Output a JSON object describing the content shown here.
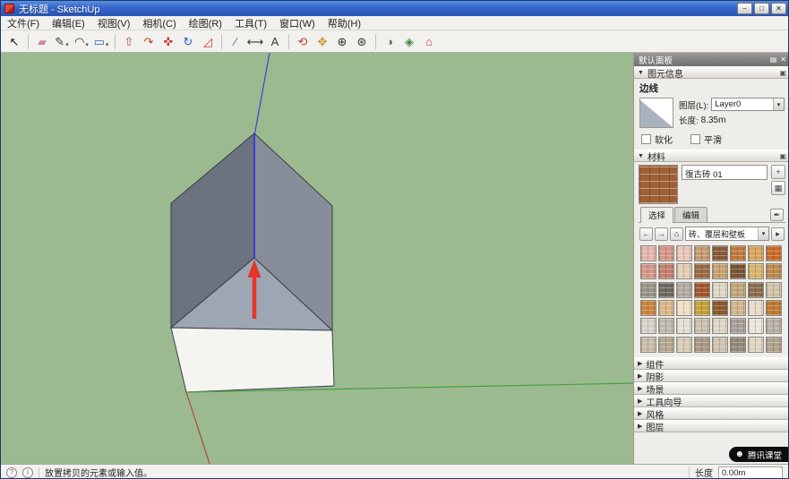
{
  "window": {
    "title": "无标题 - SketchUp",
    "controls": {
      "minimize": "–",
      "maximize": "□",
      "close": "✕"
    }
  },
  "menu": {
    "items": [
      "文件(F)",
      "编辑(E)",
      "视图(V)",
      "相机(C)",
      "绘图(R)",
      "工具(T)",
      "窗口(W)",
      "帮助(H)"
    ]
  },
  "icons": {
    "collapse": "▼",
    "expand": "▶",
    "dropdown": "▾",
    "detach": "▣",
    "panel_options": "▤",
    "close": "✕",
    "back": "←",
    "forward": "→",
    "home": "⌂",
    "detail": "▸",
    "sample": "✒",
    "create_material": "+",
    "pane": "▦",
    "help": "?",
    "info": "i",
    "bell": "☻"
  },
  "toolbar": {
    "groups": [
      [
        {
          "name": "select-tool",
          "glyph": "↖",
          "color": "#1a1a1a",
          "dropdown": false
        }
      ],
      [
        {
          "name": "eraser-tool",
          "glyph": "▰",
          "color": "#d488a8",
          "dropdown": false
        },
        {
          "name": "line-tool",
          "glyph": "✎",
          "color": "#333333",
          "dropdown": true
        },
        {
          "name": "arc-tool",
          "glyph": "◠",
          "color": "#333333",
          "dropdown": true
        },
        {
          "name": "shapes-tool",
          "glyph": "▭",
          "color": "#2f5fc4",
          "dropdown": true
        }
      ],
      [
        {
          "name": "pushpull-tool",
          "glyph": "⇧",
          "color": "#b34a26",
          "dropdown": false
        },
        {
          "name": "followme-tool",
          "glyph": "↷",
          "color": "#b34a26",
          "dropdown": false
        },
        {
          "name": "move-tool",
          "glyph": "✜",
          "color": "#c43a2e",
          "dropdown": false
        },
        {
          "name": "rotate-tool",
          "glyph": "↻",
          "color": "#2f5fc4",
          "dropdown": false
        },
        {
          "name": "scale-tool",
          "glyph": "◿",
          "color": "#c43a2e",
          "dropdown": false
        }
      ],
      [
        {
          "name": "tape-measure-tool",
          "glyph": "∕",
          "color": "#7a4fa0",
          "dropdown": false
        },
        {
          "name": "dimension-tool",
          "glyph": "⟷",
          "color": "#333333",
          "dropdown": false
        },
        {
          "name": "text-tool",
          "glyph": "A",
          "color": "#333333",
          "dropdown": false
        }
      ],
      [
        {
          "name": "orbit-tool",
          "glyph": "⟲",
          "color": "#c43a2e",
          "dropdown": false
        },
        {
          "name": "pan-tool",
          "glyph": "✥",
          "color": "#c9972f",
          "dropdown": false
        },
        {
          "name": "zoom-tool",
          "glyph": "⊕",
          "color": "#333333",
          "dropdown": false
        },
        {
          "name": "zoom-extents-tool",
          "glyph": "⊛",
          "color": "#333333",
          "dropdown": false
        }
      ],
      [
        {
          "name": "styles-tool",
          "glyph": "◑",
          "color": "#6a6a6a",
          "dropdown": false
        },
        {
          "name": "materials-tool",
          "glyph": "◈",
          "color": "#3f8a3f",
          "dropdown": false
        },
        {
          "name": "warehouse-tool",
          "glyph": "⌂",
          "color": "#c43a2e",
          "dropdown": false
        }
      ]
    ]
  },
  "viewport": {
    "colors": {
      "bg": "#9cba8f",
      "roof_left": "#6b7280",
      "roof_right": "#878e99",
      "gable": "#9da7b4",
      "front": "#f4f4f1",
      "edge": "#3a3f47",
      "blue_edge": "#2230dd",
      "blue_axis": "#3a43d8",
      "green_axis": "#4a9e43",
      "red_axis": "#b5443c",
      "arrow": "#e53429"
    }
  },
  "panel": {
    "title": "默认面板",
    "entity_info": {
      "header": "图元信息",
      "type": "边线",
      "layer_label": "图层(L):",
      "layer_value": "Layer0",
      "length_label": "长度:",
      "length_value": "8.35m",
      "soften": "软化",
      "smooth": "平滑"
    },
    "materials": {
      "header": "材料",
      "name": "復古砖 01",
      "tabs": [
        "选择",
        "编辑"
      ],
      "active_tab": 0,
      "category": "砖、覆层和壁板",
      "swatches": [
        "#e6b5ac",
        "#d89588",
        "#e9c6bc",
        "#c59a70",
        "#8a5a38",
        "#c07a3c",
        "#d9a45e",
        "#cc6a2a",
        "#d6978a",
        "#c57f70",
        "#e4ceb2",
        "#9c6b44",
        "#c8a26e",
        "#7c5434",
        "#d8b46c",
        "#bd8a4c",
        "#9b948b",
        "#6f6962",
        "#b2aba2",
        "#a2562e",
        "#e0d6c3",
        "#c2a679",
        "#8b6f4f",
        "#cfc2a9",
        "#cc8440",
        "#dcb787",
        "#efe0c2",
        "#c6a235",
        "#8b5a2c",
        "#d2b48c",
        "#e8dcc9",
        "#bf7a32",
        "#d8d2c9",
        "#bfb9af",
        "#e5dfd5",
        "#cabfad",
        "#ddd5c6",
        "#a8a097",
        "#eae4d9",
        "#b8b0a3",
        "#c9bca9",
        "#b5a891",
        "#d8ccb9",
        "#a89a86",
        "#cfc2af",
        "#958a79",
        "#e0d4c1",
        "#b0a28d"
      ]
    },
    "collapsed_sections": [
      "组件",
      "阴影",
      "场景",
      "工具向导",
      "风格",
      "图层"
    ]
  },
  "statusbar": {
    "hint": "放置拷贝的元素或输入值。",
    "measure_label": "长度",
    "measure_value": "0.00m"
  },
  "notification": {
    "text": "腾讯课堂"
  }
}
